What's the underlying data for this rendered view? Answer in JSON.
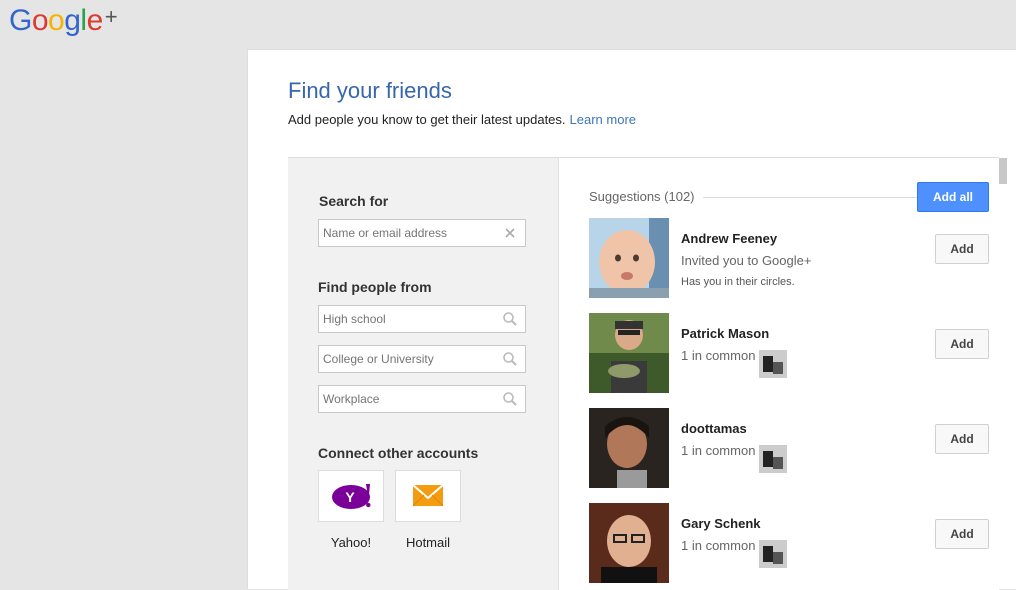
{
  "logo": {
    "letters": [
      "G",
      "o",
      "o",
      "g",
      "l",
      "e"
    ],
    "plus": "+",
    "colors": [
      "#3266cc",
      "#dd3b30",
      "#f5b400",
      "#3266cc",
      "#2aa14c",
      "#dd3b30"
    ]
  },
  "page": {
    "title": "Find your friends",
    "subtitle": "Add people you know to get their latest updates.",
    "learn_more": "Learn more"
  },
  "left": {
    "search_label": "Search for",
    "search_placeholder": "Name or email address",
    "find_label": "Find people from",
    "fields": [
      {
        "placeholder": "High school"
      },
      {
        "placeholder": "College or University"
      },
      {
        "placeholder": "Workplace"
      }
    ],
    "connect_label": "Connect other accounts",
    "accounts": [
      {
        "name": "Yahoo!",
        "icon": "yahoo-icon",
        "color": "#7b0099"
      },
      {
        "name": "Hotmail",
        "icon": "hotmail-envelope-icon",
        "color": "#f39c12"
      }
    ]
  },
  "right": {
    "suggestions_label": "Suggestions (102)",
    "add_all": "Add all",
    "people": [
      {
        "name": "Andrew Feeney",
        "line2": "Invited you to Google+",
        "line3": "Has you in their circles.",
        "button": "Add"
      },
      {
        "name": "Patrick Mason",
        "line2": "1 in common",
        "button": "Add"
      },
      {
        "name": "doottamas",
        "line2": "1 in common",
        "button": "Add"
      },
      {
        "name": "Gary Schenk",
        "line2": "1 in common",
        "button": "Add"
      }
    ]
  }
}
